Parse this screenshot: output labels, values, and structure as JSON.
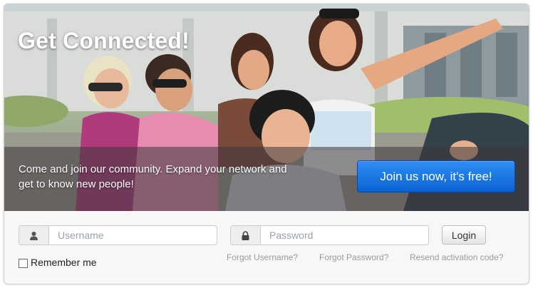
{
  "hero": {
    "title": "Get Connected!",
    "tagline": "Come and join our community. Expand your network and get to know new people!",
    "join_label": "Join us now, it's free!",
    "image": "group-of-friends-photo"
  },
  "login": {
    "username_placeholder": "Username",
    "password_placeholder": "Password",
    "login_label": "Login",
    "remember_label": "Remember me",
    "forgot_username": "Forgot Username?",
    "forgot_password": "Forgot Password?",
    "resend_activation": "Resend activation code?"
  },
  "icons": {
    "user": "user-icon",
    "lock": "lock-icon"
  },
  "colors": {
    "join_button": "#0a62d2",
    "link": "#9a9a9a"
  }
}
